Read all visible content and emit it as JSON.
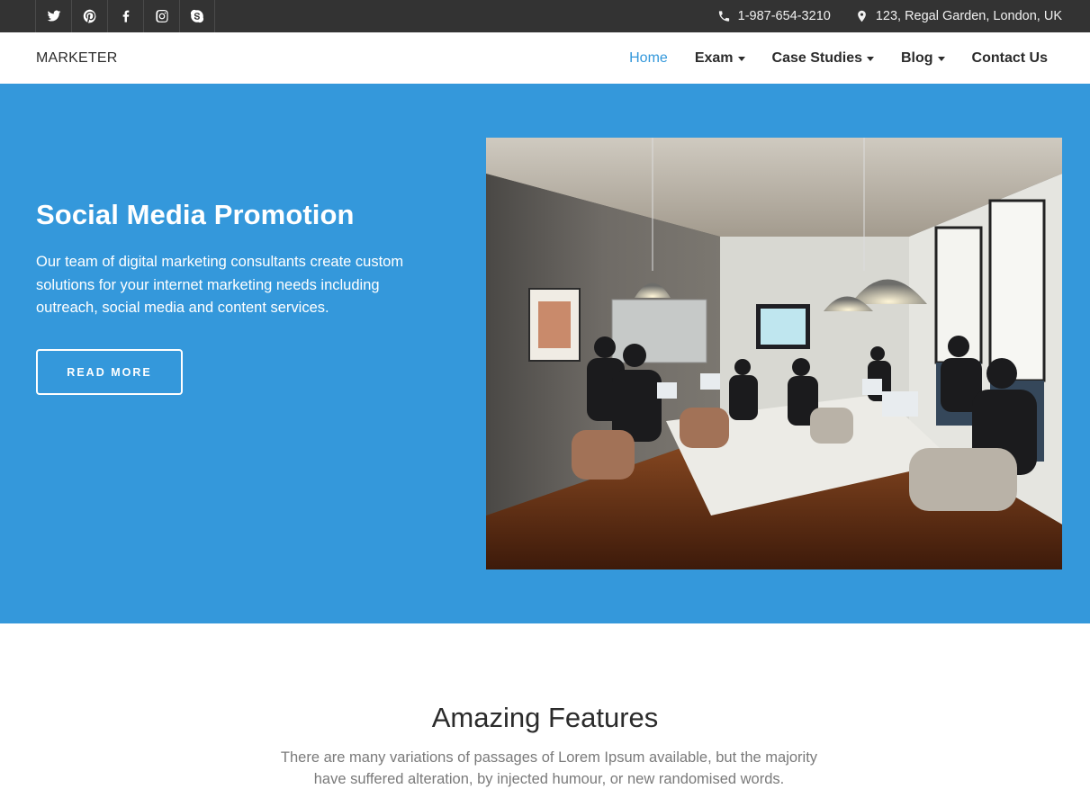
{
  "topbar": {
    "social": [
      {
        "icon": "twitter-icon"
      },
      {
        "icon": "pinterest-icon"
      },
      {
        "icon": "facebook-icon"
      },
      {
        "icon": "instagram-icon"
      },
      {
        "icon": "skype-icon"
      }
    ],
    "phone": "1-987-654-3210",
    "address": "123, Regal Garden, London, UK"
  },
  "navbar": {
    "brand": "MARKETER",
    "menu": [
      {
        "label": "Home",
        "active": true
      },
      {
        "label": "Exam",
        "dropdown": true
      },
      {
        "label": "Case Studies",
        "dropdown": true
      },
      {
        "label": "Blog",
        "dropdown": true
      },
      {
        "label": "Contact Us"
      }
    ]
  },
  "hero": {
    "title": "Social Media Promotion",
    "text": "Our team of digital marketing consultants create custom solutions for your internet marketing needs including outreach, social media and content services.",
    "button": "READ MORE",
    "background": "#3498db"
  },
  "features": {
    "title": "Amazing Features",
    "subtitle": "There are many variations of passages of Lorem Ipsum available, but the majority have suffered alteration, by injected humour, or new randomised words."
  }
}
